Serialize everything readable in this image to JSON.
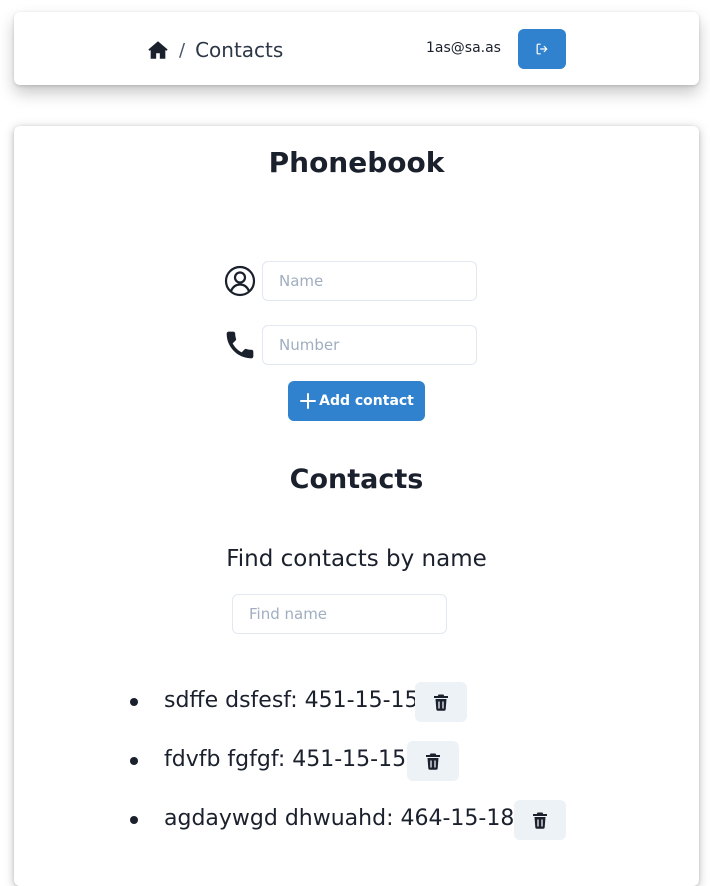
{
  "header": {
    "breadcrumb": {
      "home_icon": "home-icon",
      "separator": "/",
      "current": "Contacts"
    },
    "user_email": "1as@sa.as",
    "logout_icon": "logout-icon",
    "colors": {
      "primary": "#3182ce"
    }
  },
  "phonebook": {
    "title": "Phonebook",
    "name_field": {
      "icon": "user-circle-icon",
      "placeholder": "Name",
      "value": ""
    },
    "number_field": {
      "icon": "phone-icon",
      "placeholder": "Number",
      "value": ""
    },
    "add_button": {
      "icon": "plus-icon",
      "label": "Add contact"
    }
  },
  "contacts": {
    "title": "Contacts",
    "filter_label": "Find contacts by name",
    "filter_field": {
      "placeholder": "Find name",
      "value": ""
    },
    "items": [
      {
        "text": "sdffe dsfesf: 451-15-15",
        "delete_icon": "trash-icon"
      },
      {
        "text": "fdvfb fgfgf: 451-15-15",
        "delete_icon": "trash-icon"
      },
      {
        "text": "agdaywgd dhwuahd: 464-15-18",
        "delete_icon": "trash-icon"
      }
    ]
  }
}
